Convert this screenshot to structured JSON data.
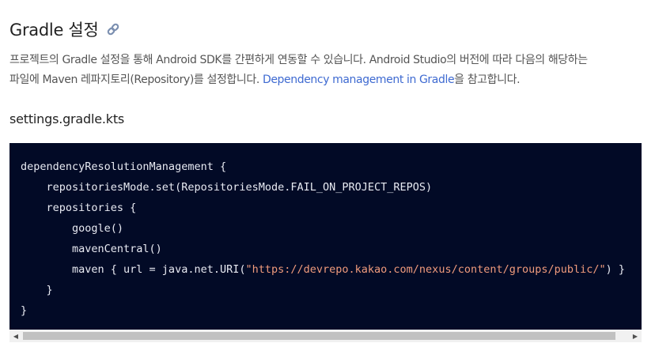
{
  "section": {
    "title": "Gradle 설정",
    "link_icon": "link-icon"
  },
  "description": {
    "line1": "프로젝트의 Gradle 설정을 통해 Android SDK를 간편하게 연동할 수 있습니다. Android Studio의 버전에 따라 다음의 해당하는",
    "line2_before": "파일에 Maven 레파지토리(Repository)를 설정합니다. ",
    "link_text": "Dependency management in Gradle",
    "line2_after": "을 참고합니다."
  },
  "code": {
    "filename": "settings.gradle.kts",
    "lines": [
      "dependencyResolutionManagement {",
      "    repositoriesMode.set(RepositoriesMode.FAIL_ON_PROJECT_REPOS)",
      "    repositories {",
      "        google()",
      "        mavenCentral()",
      "        maven { url = java.net.URI(",
      "    }",
      "}"
    ],
    "maven_url": "\"https://devrepo.kakao.com/nexus/content/groups/public/\"",
    "maven_suffix": ") }"
  },
  "scrollbar": {
    "left_arrow": "◀",
    "right_arrow": "▶",
    "position": 0
  },
  "colors": {
    "code_background": "#020a26",
    "string": "#f09b7c",
    "link": "#3e6ad1"
  }
}
